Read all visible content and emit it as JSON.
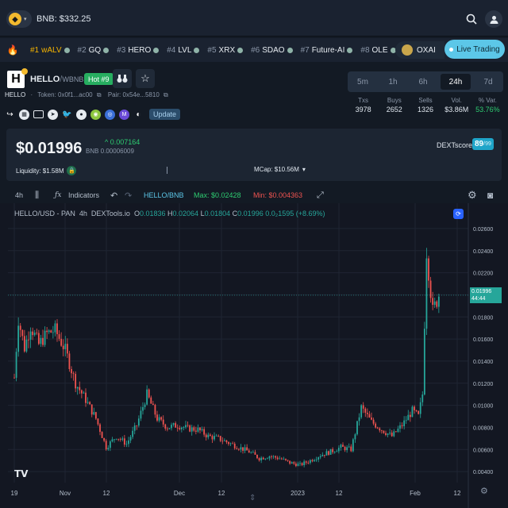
{
  "topbar": {
    "bnb_price": "BNB: $332.25"
  },
  "trending": {
    "items": [
      {
        "rank": "#1",
        "symbol": "wALV"
      },
      {
        "rank": "#2",
        "symbol": "GQ"
      },
      {
        "rank": "#3",
        "symbol": "HERO"
      },
      {
        "rank": "#4",
        "symbol": "LVL"
      },
      {
        "rank": "#5",
        "symbol": "XRX"
      },
      {
        "rank": "#6",
        "symbol": "SDAO"
      },
      {
        "rank": "#7",
        "symbol": "Future-AI"
      },
      {
        "rank": "#8",
        "symbol": "OLE"
      },
      {
        "rank": "#9",
        "symbol": ""
      }
    ],
    "featured": "OXAI",
    "live_label": "Live Trading"
  },
  "token": {
    "name": "HELLO",
    "separator": "/",
    "pair": "WBNB",
    "hot_badge": "Hot #9",
    "symbol": "HELLO",
    "token_label": "Token:",
    "token_addr": "0x0f1...ac00",
    "pair_label": "Pair:",
    "pair_addr": "0x54e...5810",
    "update_label": "Update"
  },
  "timeframes": [
    {
      "label": "5m",
      "active": false
    },
    {
      "label": "1h",
      "active": false
    },
    {
      "label": "6h",
      "active": false
    },
    {
      "label": "24h",
      "active": true
    },
    {
      "label": "7d",
      "active": false
    }
  ],
  "stats": [
    {
      "label": "Txs",
      "value": "3978",
      "color": ""
    },
    {
      "label": "Buys",
      "value": "2652",
      "color": ""
    },
    {
      "label": "Sells",
      "value": "1326",
      "color": ""
    },
    {
      "label": "Vol.",
      "value": "$3.86M",
      "color": ""
    },
    {
      "label": "% Var.",
      "value": "53.76%",
      "color": "green"
    }
  ],
  "price": {
    "usd": "$0.01996",
    "change": "0.007164",
    "bnb": "BNB 0.00006009",
    "dext_label": "DEXTscore",
    "dext_score": "89",
    "dext_max": "/99",
    "liquidity": "Liquidity: $1.58M",
    "mcap": "MCap: $10.56M"
  },
  "chart_toolbar": {
    "interval": "4h",
    "indicators": "Indicators",
    "pair": "HELLO/BNB",
    "max": "Max: $0.02428",
    "min": "Min: $0.004363"
  },
  "chart_legend": {
    "series": "HELLO/USD - PAN",
    "interval": "4h",
    "source": "DEXTools.io",
    "o_label": "O",
    "o": "0.01836",
    "h_label": "H",
    "h": "0.02064",
    "l_label": "L",
    "l": "0.01804",
    "c_label": "C",
    "c": "0.01996",
    "change": "0.0₂1595 (+8.69%)"
  },
  "price_tag": {
    "value": "0.01996",
    "countdown": "44:44"
  },
  "colors": {
    "up": "#26a69a",
    "down": "#ef5350",
    "accent": "#5cc7e8",
    "hot": "#27ae60"
  },
  "chart_data": {
    "type": "line",
    "title": "",
    "ylabel": "",
    "xlabel": "",
    "ylim": [
      0.003,
      0.027
    ],
    "y_ticks": [
      "0.02600",
      "0.02400",
      "0.02200",
      "0.02000",
      "0.01800",
      "0.01600",
      "0.01400",
      "0.01200",
      "0.01000",
      "0.00800",
      "0.00600",
      "0.00400"
    ],
    "x_ticks": [
      "19",
      "Nov",
      "12",
      "Dec",
      "12",
      "2023",
      "12",
      "Feb",
      "12"
    ],
    "series": [
      {
        "x_index": [
          0,
          2,
          5,
          8,
          12,
          16,
          20,
          25,
          30,
          35,
          40,
          45,
          50,
          55,
          60,
          65,
          70,
          75,
          80,
          85,
          90,
          95,
          100,
          105,
          110,
          115,
          120,
          125,
          130,
          135,
          140,
          145,
          150,
          155,
          160,
          165,
          170,
          175,
          180,
          185,
          190,
          195,
          198,
          200,
          202,
          205,
          208
        ],
        "values": [
          0.0125,
          0.0178,
          0.0152,
          0.0172,
          0.0155,
          0.0165,
          0.0168,
          0.015,
          0.012,
          0.0105,
          0.0088,
          0.0062,
          0.0072,
          0.0065,
          0.0082,
          0.011,
          0.0088,
          0.008,
          0.0082,
          0.0079,
          0.0078,
          0.0072,
          0.007,
          0.0066,
          0.0062,
          0.0058,
          0.0052,
          0.0054,
          0.0052,
          0.0048,
          0.0046,
          0.005,
          0.0055,
          0.0058,
          0.0062,
          0.006,
          0.0098,
          0.0085,
          0.0078,
          0.0072,
          0.0082,
          0.0095,
          0.009,
          0.011,
          0.024,
          0.0185,
          0.02
        ]
      }
    ]
  }
}
